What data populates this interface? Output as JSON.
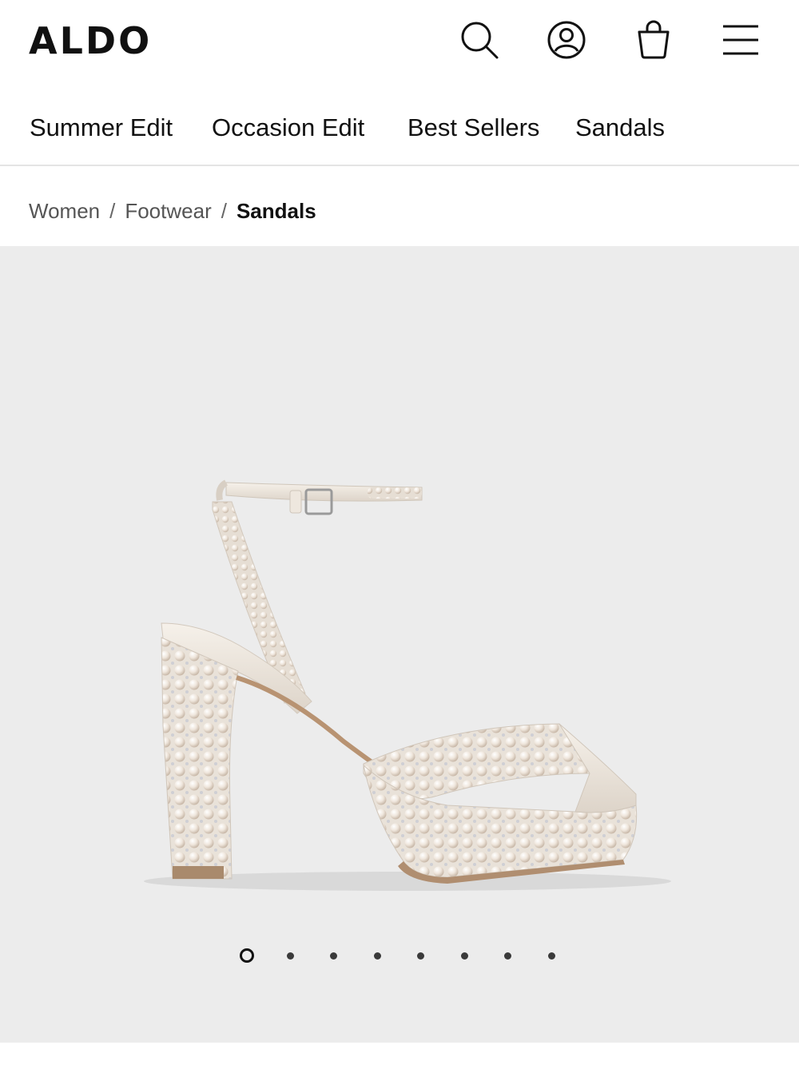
{
  "header": {
    "logo": "ALDO",
    "icons": [
      "search-icon",
      "account-icon",
      "shopping-bag-icon",
      "menu-icon"
    ]
  },
  "nav": {
    "items": [
      "Summer Edit",
      "Occasion Edit",
      "Best Sellers",
      "Sandals"
    ]
  },
  "breadcrumb": {
    "items": [
      "Women",
      "Footwear"
    ],
    "separator": "/",
    "current": "Sandals"
  },
  "gallery": {
    "image_count": 8,
    "active_index": 0,
    "background": "#ececec",
    "image": "pearl-embellished-platform-sandal"
  }
}
